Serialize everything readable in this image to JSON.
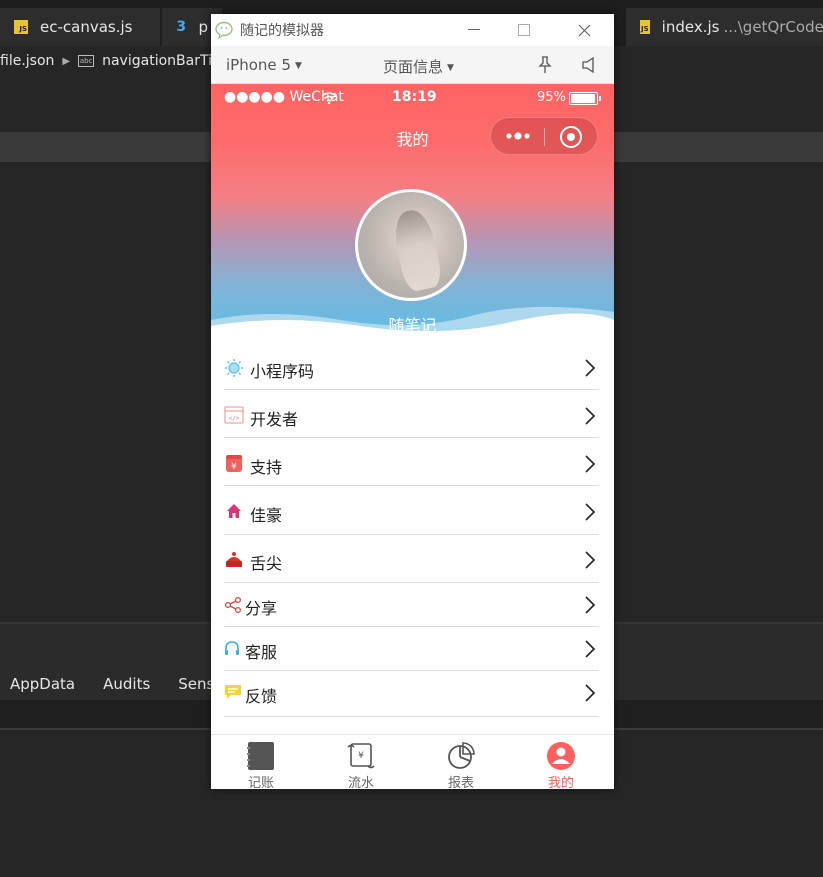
{
  "ide": {
    "tabs": [
      {
        "label": "ec-canvas.js",
        "icon": "js-file-icon"
      },
      {
        "label": "p",
        "icon": "css-file-icon"
      },
      {
        "label": "index.js",
        "path": "...\\getQrCode",
        "icon": "js-file-icon"
      }
    ],
    "breadcrumb": {
      "file": "file.json",
      "node": "navigationBarTi"
    },
    "devtools_tabs": [
      "AppData",
      "Audits",
      "Sensor"
    ]
  },
  "simulator": {
    "window_title": "随记的模拟器",
    "device": "iPhone 5",
    "page_info": "页面信息"
  },
  "phone": {
    "statusbar": {
      "carrier": "●●●●● WeChat",
      "time": "18:19",
      "battery": "95%",
      "battery_level": 0.95
    },
    "nav_title": "我的",
    "username": "随笔记",
    "menu": [
      {
        "label": "小程序码",
        "icon": "qrcode-sun-icon"
      },
      {
        "label": "开发者",
        "icon": "developer-code-icon"
      },
      {
        "label": "支持",
        "icon": "support-wallet-icon"
      },
      {
        "label": "佳豪",
        "icon": "home-icon"
      },
      {
        "label": "舌尖",
        "icon": "cake-icon"
      },
      {
        "label": "分享",
        "icon": "share-icon"
      },
      {
        "label": "客服",
        "icon": "headset-icon"
      },
      {
        "label": "反馈",
        "icon": "feedback-icon"
      }
    ],
    "tabbar": [
      {
        "label": "记账",
        "icon": "notebook-icon"
      },
      {
        "label": "流水",
        "icon": "scroll-bill-icon"
      },
      {
        "label": "报表",
        "icon": "pie-chart-icon"
      },
      {
        "label": "我的",
        "icon": "user-profile-icon",
        "active": true
      }
    ],
    "colors": {
      "accent": "#ff5f5f",
      "hero_top": "#ff6464",
      "hero_bottom": "#60bde6"
    }
  }
}
